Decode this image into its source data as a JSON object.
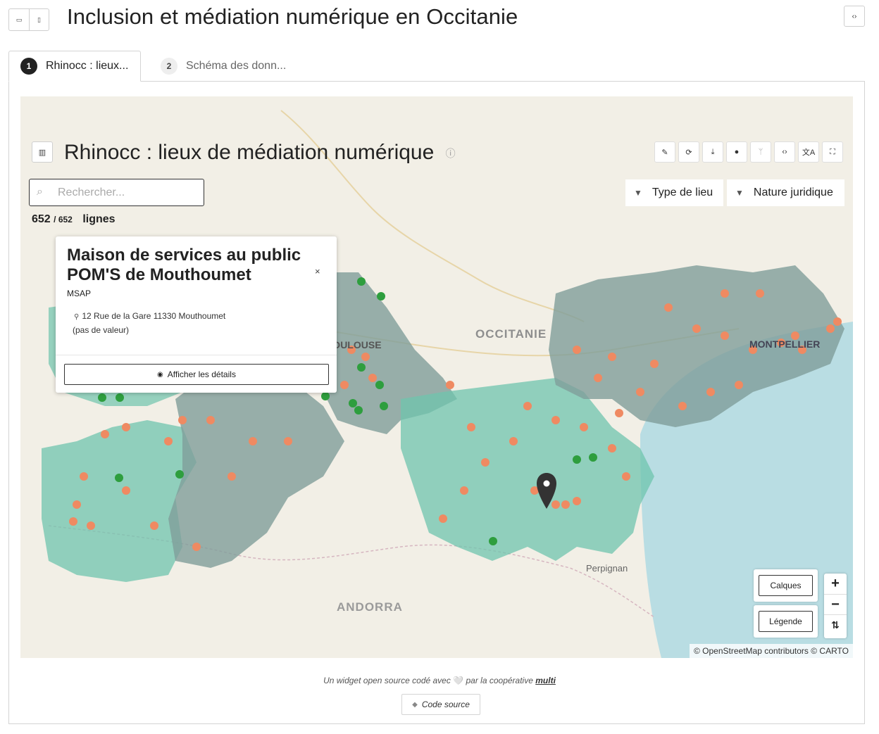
{
  "header": {
    "title": "Inclusion et médiation numérique en Occitanie",
    "view_toggle": [
      {
        "icon": "horizontal-layout-icon",
        "glyph": "▭"
      },
      {
        "icon": "vertical-layout-icon",
        "glyph": "▯"
      }
    ],
    "embed_icon": "‹›"
  },
  "tabs": [
    {
      "number": "1",
      "label": "Rhinocc : lieux...",
      "active": true
    },
    {
      "number": "2",
      "label": "Schéma des donn...",
      "active": false
    }
  ],
  "map_view": {
    "title": "Rhinocc : lieux de médiation numérique",
    "info_icon": "ⓘ",
    "map_icon": "▥",
    "toolbar": [
      {
        "name": "edit-icon",
        "glyph": "✎"
      },
      {
        "name": "refresh-icon",
        "glyph": "⟳"
      },
      {
        "name": "download-icon",
        "glyph": "⤓"
      },
      {
        "name": "user-icon",
        "glyph": "●"
      },
      {
        "name": "fork-icon",
        "glyph": "ᛘ"
      },
      {
        "name": "code-icon",
        "glyph": "‹›"
      },
      {
        "name": "translate-icon",
        "glyph": "文A"
      },
      {
        "name": "fullscreen-icon",
        "glyph": "⛶"
      }
    ],
    "search": {
      "placeholder": "Rechercher..."
    },
    "count": {
      "shown": "652",
      "total": "/ 652",
      "unit": "lignes"
    },
    "filters": [
      {
        "label": "Type de lieu",
        "icon": "filter-icon"
      },
      {
        "label": "Nature juridique",
        "icon": "filter-icon"
      }
    ],
    "map_labels": [
      "OCCITANIE",
      "TOULOUSE",
      "MONTPELLIER",
      "Perpignan",
      "ANDORRA"
    ],
    "popup": {
      "title": "Maison de services au public POM'S de Mouthoumet",
      "subtitle": "MSAP",
      "address": "12 Rue de la Gare 11330 Mouthoumet",
      "no_value": "(pas de valeur)",
      "details_button": "Afficher les détails",
      "close": "×"
    },
    "layers_button": "Calques",
    "legend_button": "Légende",
    "zoom": {
      "in": "+",
      "out": "−",
      "reset": "⇅"
    },
    "attribution": "© OpenStreetMap contributors © CARTO",
    "colors": {
      "orange": "#ef8a62",
      "green": "#2e9e3e",
      "teal_region": "#6fc4ad",
      "grey_region": "#7f9e9a",
      "sea": "#b9dde3",
      "land": "#f2efe6"
    }
  },
  "footer": {
    "text_before": "Un widget open source codé avec",
    "heart": "🤍",
    "text_after": "par la coopérative",
    "link": "multi",
    "source_button": "Code source"
  }
}
